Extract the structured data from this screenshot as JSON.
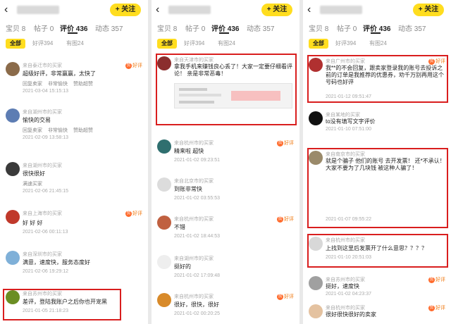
{
  "common": {
    "back_glyph": "‹",
    "follow_label": "+ 关注",
    "badge_label": "好评",
    "badge_glyph": "赞"
  },
  "panels": [
    {
      "tabs": {
        "t0": "宝贝 8",
        "t1": "帖子 0",
        "t2": "评价 436",
        "t3": "动态 357"
      },
      "filters": {
        "f0": "全部",
        "f1": "好评394",
        "f2": "有图24"
      },
      "reviews": [
        {
          "meta": "来自泰迁市的买家",
          "text": "超级好评，非常赢赢，太快了",
          "replies": [
            "回复卖家",
            "非常愉快",
            "赞助超赞"
          ],
          "date": "2021-03-04 15:15:13"
        },
        {
          "meta": "来自湖州市的买家",
          "text": "愉快的交易",
          "replies": [
            "回复卖家",
            "非常愉快",
            "赞助超赞"
          ],
          "date": "2021-02-09 13:58:13"
        },
        {
          "meta": "来自湖州市的买家",
          "text": "很快很好",
          "replies": [
            "满速买家"
          ],
          "date": "2021-02-06 21:45:15"
        },
        {
          "meta": "来自上海市的买家",
          "text": "好 好 好",
          "replies": [],
          "date": "2021-02-06 00:11:13"
        },
        {
          "meta": "来自深圳市的买家",
          "text": "满意，速度快，服务态度好",
          "replies": [],
          "date": "2021-02-06 19:29:12"
        },
        {
          "meta": "来自苏州市的买家",
          "text": "差评，登陆我账户之后你也开宠黑",
          "replies": [],
          "date": "2021-01-05 21:18:23"
        }
      ]
    },
    {
      "tabs": {
        "t0": "宝贝 8",
        "t1": "帖子 0",
        "t2": "评价 436",
        "t3": "动态 357"
      },
      "filters": {
        "f0": "全部",
        "f1": "好评394",
        "f2": "有图24"
      },
      "reviews": [
        {
          "meta": "来自天津市的买家",
          "text": "拿我手机来赚钱良心丢了！大家一定要仔细看评论！ 亲是非常恶毒！",
          "date": ""
        },
        {
          "meta": "来自杭州市的买家",
          "text": "精来啦 超快",
          "date": "2021-01-02 09:23:51"
        },
        {
          "meta": "来自北京市的买家",
          "text": "到账非常快",
          "date": "2021-01-02 03:55:53"
        },
        {
          "meta": "来自杭州市的买家",
          "text": "不错",
          "date": "2021-01-02 18:44:53"
        },
        {
          "meta": "来自湖州市的买家",
          "text": "挺好的",
          "date": "2021-01-02 17:09:48"
        },
        {
          "meta": "来自杭州市的买家",
          "text": "很好，很快，很好",
          "date": "2021-01-02 00:20:25"
        }
      ]
    },
    {
      "tabs": {
        "t0": "宝贝 8",
        "t1": "帖子 0",
        "t2": "评价 436",
        "t3": "动态 357"
      },
      "filters": {
        "f0": "全部",
        "f1": "好评394",
        "f2": "有图24"
      },
      "reviews": [
        {
          "meta": "来自广州市的买家",
          "text": "我**的不会回复，跟卖家登录我的账号去投诉之前的订单是我推荐的优惠券，劝千万别再用这个号码也好评",
          "date": "2021-01-12 09:51:47"
        },
        {
          "meta": "来自某地的买家",
          "text": "to没有填写文字评价",
          "date": "2021-01-10 07:51:00"
        },
        {
          "meta": "来自南京市的买家",
          "text": "就是个骗子 他们的账号 去开发票！ 还*不承认！ 大家不要为了几块钱 被这种人骗了！",
          "date": "2021-01-07 09:55:22"
        },
        {
          "meta": "来自杭州市的买家",
          "text": "上找到这里后发票开了什么意思？？？？",
          "date": "2021-01-10 20:51:03"
        },
        {
          "meta": "来自苏州市的买家",
          "text": "挺好，速度快",
          "date": "2021-01-02 04:23:37"
        },
        {
          "meta": "来自杭州市的买家",
          "text": "很好很快很好的卖家",
          "date": ""
        }
      ]
    }
  ],
  "colors": {
    "accent": "#ffdd1f",
    "highlight_box": "#d91e1e",
    "badge": "#f07a12"
  }
}
